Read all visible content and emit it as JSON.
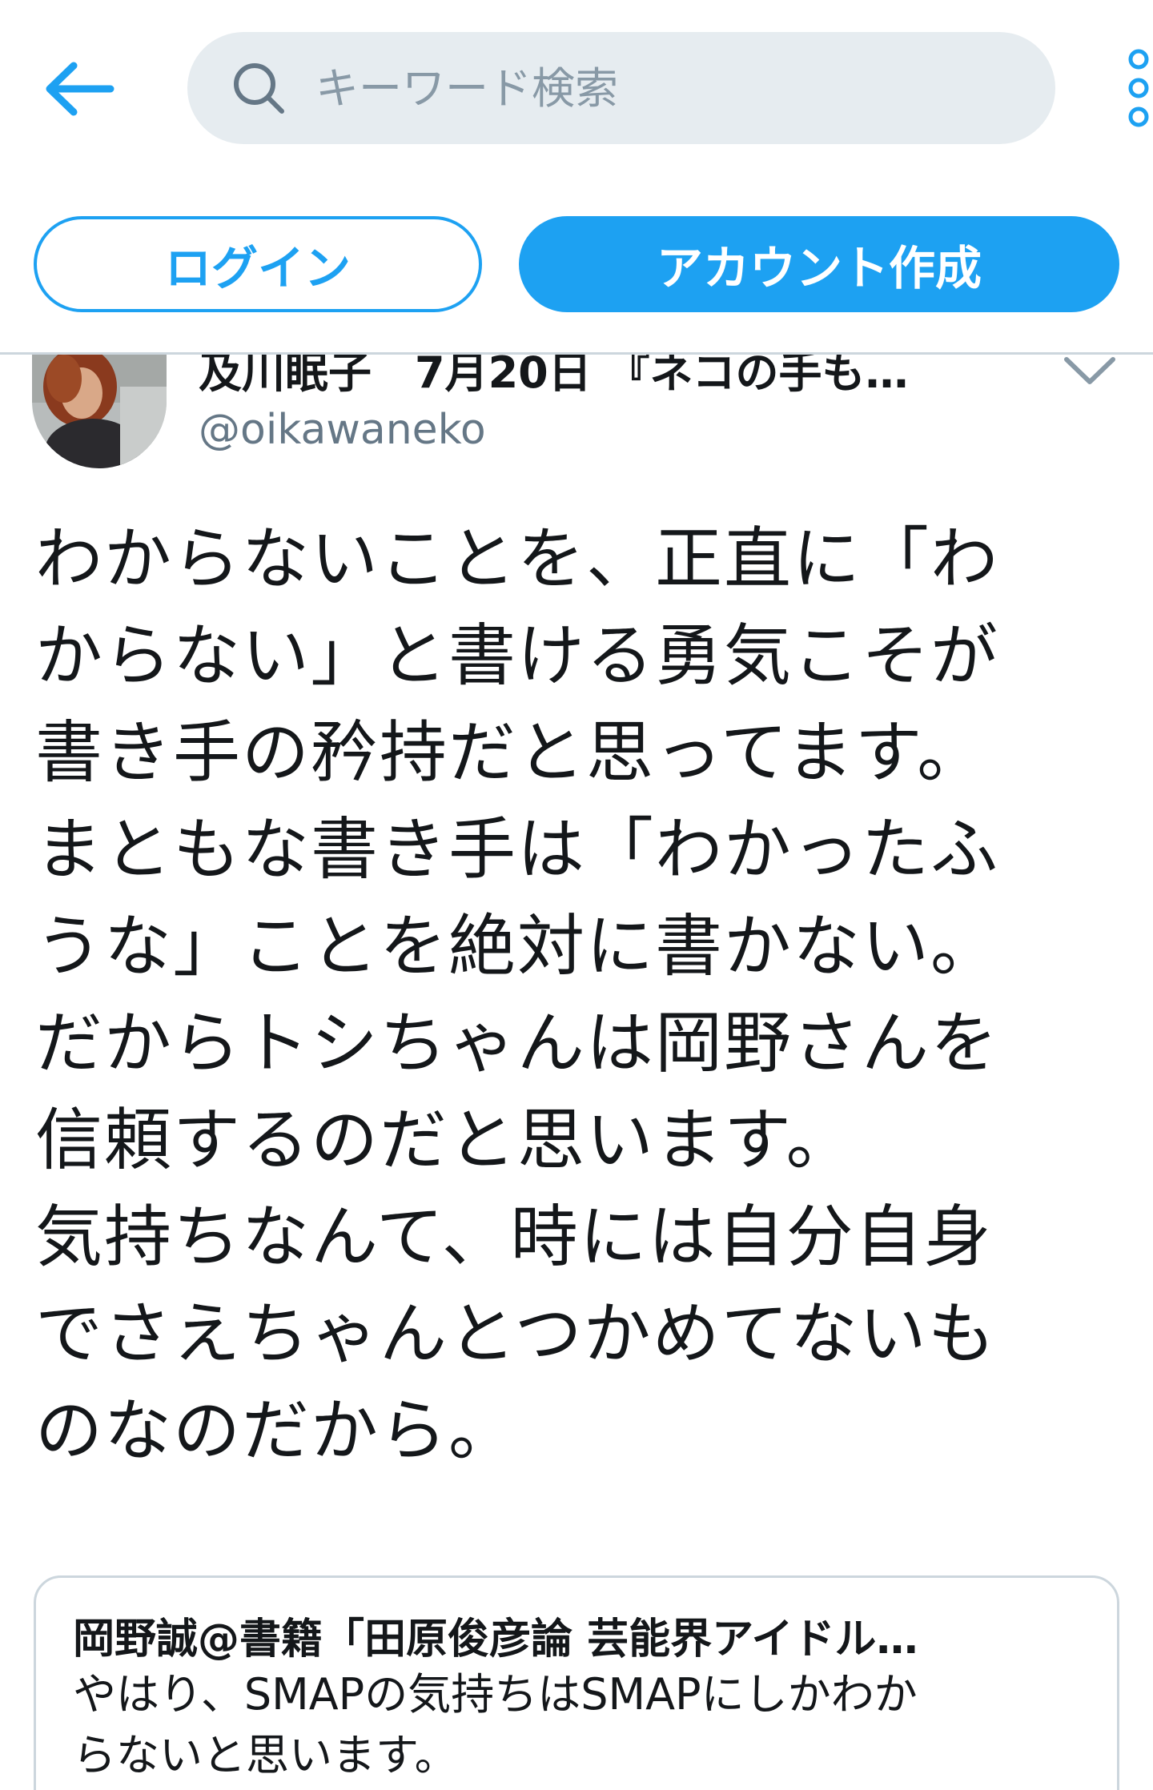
{
  "search": {
    "placeholder": "キーワード検索"
  },
  "auth": {
    "login_label": "ログイン",
    "signup_label": "アカウント作成"
  },
  "tweet": {
    "author_name": "及川眠子",
    "date": "7月20日",
    "tagline": "『ネコの手も…",
    "handle": "@oikawaneko",
    "text": "わからないことを、正直に「わ\nからない」と書ける勇気こそが\n書き手の矜持だと思ってます。\nまともな書き手は「わかったふ\nうな」ことを絶対に書かない。\nだからトシちゃんは岡野さんを\n信頼するのだと思います。\n気持ちなんて、時には自分自身\nでさえちゃんとつかめてないも\nのなのだから。"
  },
  "quoted_tweet": {
    "author": "岡野誠@書籍「田原俊彦論 芸能界アイドル…",
    "text": "やはり、SMAPの気持ちはSMAPにしかわか\nらないと思います。"
  },
  "colors": {
    "accent": "#1da1f2",
    "search_bg": "#e6ecf0",
    "secondary_text": "#657786",
    "border": "#ccd6dd"
  },
  "icons": {
    "back": "arrow-left-icon",
    "search": "search-icon",
    "more": "vertical-ellipsis-icon",
    "caret": "chevron-down-icon"
  }
}
